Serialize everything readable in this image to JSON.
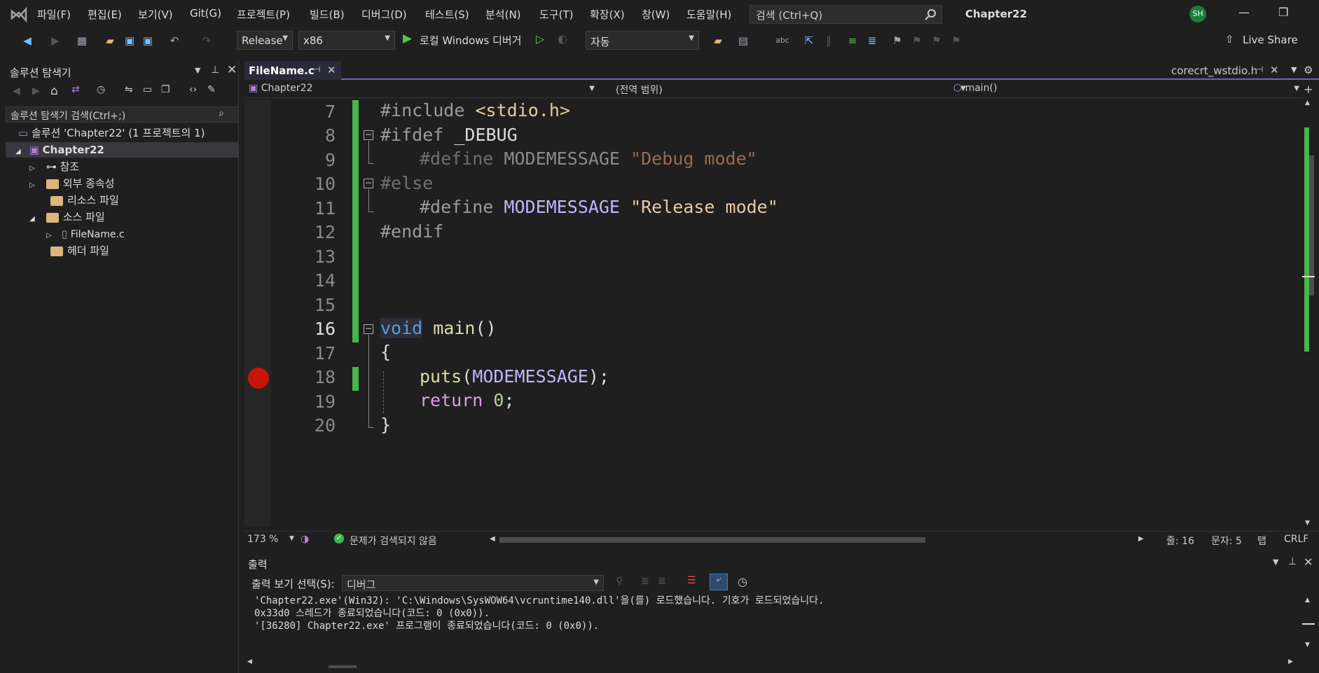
{
  "menu": [
    "파일(F)",
    "편집(E)",
    "보기(V)",
    "Git(G)",
    "프로젝트(P)",
    "빌드(B)",
    "디버그(D)",
    "테스트(S)",
    "분석(N)",
    "도구(T)",
    "확장(X)",
    "창(W)",
    "도움말(H)"
  ],
  "search_placeholder": "검색 (Ctrl+Q)",
  "window_title": "Chapter22",
  "avatar": "SH",
  "toolbar": {
    "config": "Release",
    "platform": "x86",
    "run_label": "로컬 Windows 디버거",
    "auto": "자동",
    "live_share": "Live Share"
  },
  "explorer": {
    "title": "솔루션 탐색기",
    "search": "솔루션 탐색기 검색(Ctrl+;)",
    "solution": "솔루션 'Chapter22' (1 프로젝트의 1)",
    "project": "Chapter22",
    "items": [
      "참조",
      "외부 종속성",
      "리소스 파일",
      "소스 파일",
      "FileName.c",
      "헤더 파일"
    ]
  },
  "tabs": {
    "active": "FileName.c",
    "right": "corecrt_wstdio.h"
  },
  "navbar": {
    "project": "Chapter22",
    "scope": "(전역 범위)",
    "member": "main()"
  },
  "code": {
    "line_numbers": [
      "7",
      "8",
      "9",
      "10",
      "11",
      "12",
      "13",
      "14",
      "15",
      "16",
      "17",
      "18",
      "19",
      "20"
    ]
  },
  "status": {
    "zoom": "173 %",
    "issues": "문제가 검색되지 않음",
    "line": "줄: 16",
    "col": "문자: 5",
    "tab": "탭",
    "eol": "CRLF"
  },
  "output": {
    "title": "출력",
    "source_label": "출력 보기 선택(S):",
    "source": "디버그",
    "lines": [
      "'Chapter22.exe'(Win32): 'C:\\Windows\\SysWOW64\\vcruntime140.dll'을(를) 로드했습니다. 기호가 로드되었습니다.",
      "0x33d0 스레드가 종료되었습니다(코드: 0 (0x0)).",
      "'[36280] Chapter22.exe' 프로그램이 종료되었습니다(코드: 0 (0x0))."
    ]
  }
}
